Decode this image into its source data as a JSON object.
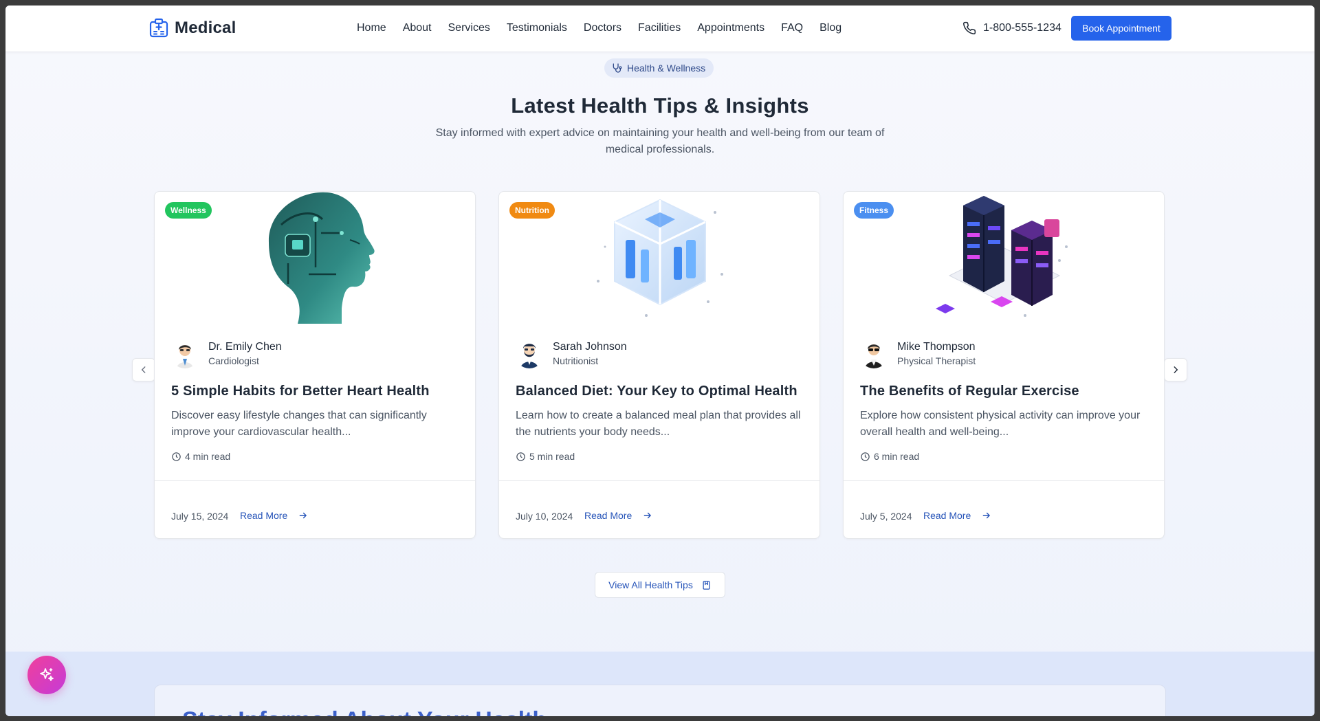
{
  "header": {
    "logo_text": "Medical",
    "nav": [
      "Home",
      "About",
      "Services",
      "Testimonials",
      "Doctors",
      "Facilities",
      "Appointments",
      "FAQ",
      "Blog"
    ],
    "phone": "1-800-555-1234",
    "book_label": "Book Appointment"
  },
  "section": {
    "badge": "Health & Wellness",
    "title": "Latest Health Tips & Insights",
    "subtitle": "Stay informed with expert advice on maintaining your health and well-being from our team of medical professionals."
  },
  "cards": [
    {
      "tag": "Wellness",
      "tag_color": "#22c55e",
      "author": "Dr. Emily Chen",
      "role": "Cardiologist",
      "title": "5 Simple Habits for Better Heart Health",
      "desc": "Discover easy lifestyle changes that can significantly improve your cardiovascular health...",
      "read_time": "4 min read",
      "date": "July 15, 2024",
      "read_more": "Read More"
    },
    {
      "tag": "Nutrition",
      "tag_color": "#f08a12",
      "author": "Sarah Johnson",
      "role": "Nutritionist",
      "title": "Balanced Diet: Your Key to Optimal Health",
      "desc": "Learn how to create a balanced meal plan that provides all the nutrients your body needs...",
      "read_time": "5 min read",
      "date": "July 10, 2024",
      "read_more": "Read More"
    },
    {
      "tag": "Fitness",
      "tag_color": "#3b82f6",
      "author": "Mike Thompson",
      "role": "Physical Therapist",
      "title": "The Benefits of Regular Exercise",
      "desc": "Explore how consistent physical activity can improve your overall health and well-being...",
      "read_time": "6 min read",
      "date": "July 5, 2024",
      "read_more": "Read More"
    }
  ],
  "view_all": "View All Health Tips",
  "bottom": {
    "title": "Stay Informed About Your Health"
  },
  "colors": {
    "primary": "#2563eb",
    "link": "#2553b8",
    "fab_start": "#f0409b",
    "fab_end": "#c53bd8"
  }
}
